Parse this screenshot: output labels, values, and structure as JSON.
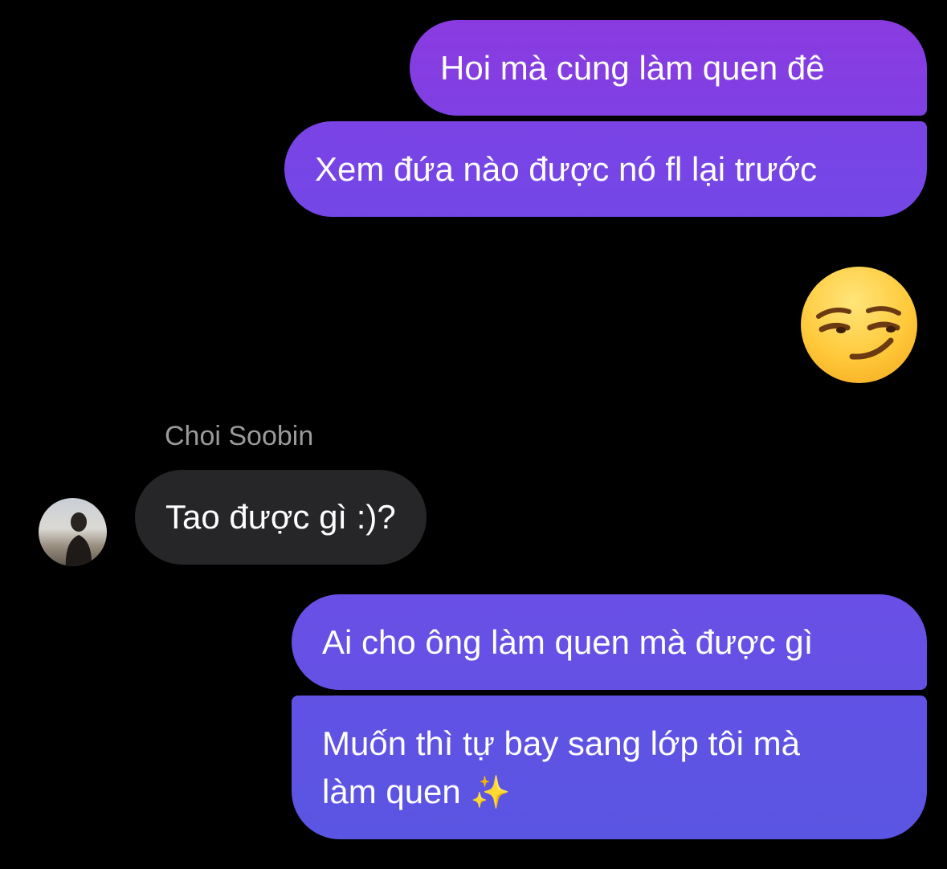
{
  "conversation": {
    "messages": [
      {
        "type": "sent",
        "text": "Hoi mà cùng làm quen đê"
      },
      {
        "type": "sent",
        "text": "Xem đứa nào được nó fl lại trước"
      },
      {
        "type": "sent-emoji",
        "emoji": "smirking-face"
      },
      {
        "type": "received",
        "sender": "Choi Soobin",
        "text": "Tao được gì :)?"
      },
      {
        "type": "sent",
        "text": "Ai cho ông làm quen mà được gì"
      },
      {
        "type": "sent",
        "line1": "Muốn thì tự bay sang lớp tôi mà",
        "line2": "làm quen",
        "emoji": "✨"
      }
    ]
  },
  "colors": {
    "background": "#000000",
    "sent_bubble_top": "#8a3be0",
    "sent_bubble_bottom": "#5a55e2",
    "received_bubble": "#262628",
    "sender_name": "#9a9a9a"
  }
}
